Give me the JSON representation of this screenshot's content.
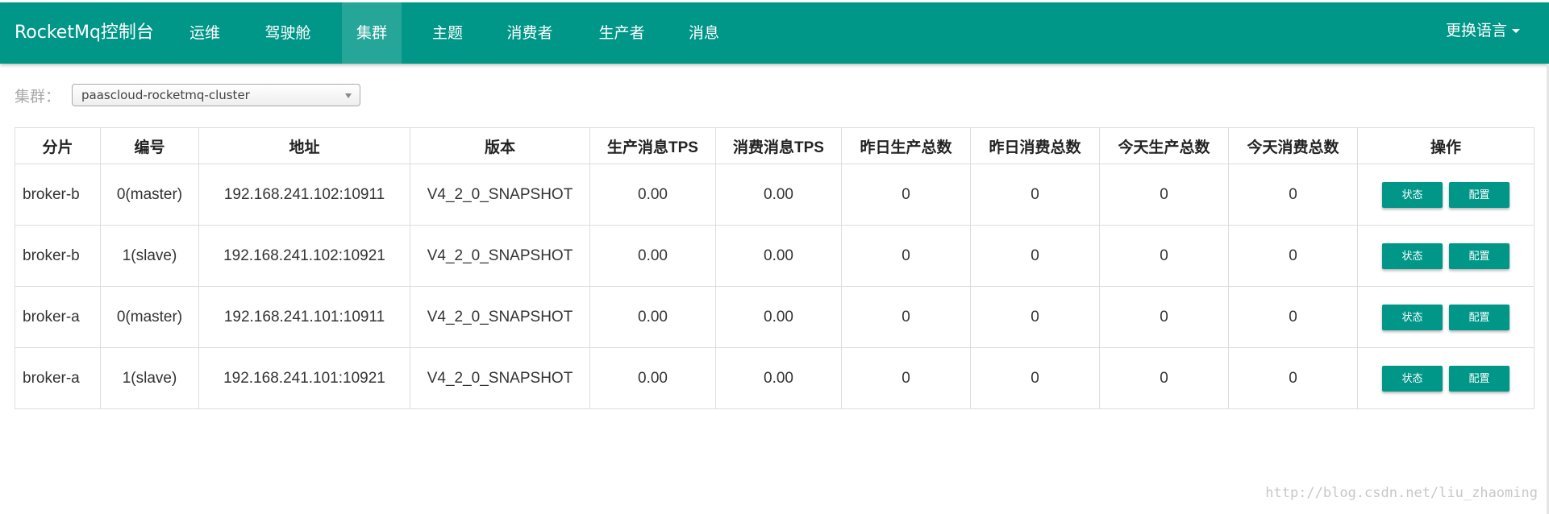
{
  "app": {
    "brand": "RocketMq控制台",
    "nav": [
      "运维",
      "驾驶舱",
      "集群",
      "主题",
      "消费者",
      "生产者",
      "消息"
    ],
    "active_nav": "集群",
    "language_label": "更换语言",
    "accent_color": "#009688"
  },
  "filter": {
    "cluster_label": "集群：",
    "cluster_value": "paascloud-rocketmq-cluster"
  },
  "table": {
    "columns": [
      "分片",
      "编号",
      "地址",
      "版本",
      "生产消息TPS",
      "消费消息TPS",
      "昨日生产总数",
      "昨日消费总数",
      "今天生产总数",
      "今天消费总数",
      "操作"
    ],
    "rows": [
      [
        "broker-b",
        "0(master)",
        "192.168.241.102:10911",
        "V4_2_0_SNAPSHOT",
        "0.00",
        "0.00",
        "0",
        "0",
        "0",
        "0"
      ],
      [
        "broker-b",
        "1(slave)",
        "192.168.241.102:10921",
        "V4_2_0_SNAPSHOT",
        "0.00",
        "0.00",
        "0",
        "0",
        "0",
        "0"
      ],
      [
        "broker-a",
        "0(master)",
        "192.168.241.101:10911",
        "V4_2_0_SNAPSHOT",
        "0.00",
        "0.00",
        "0",
        "0",
        "0",
        "0"
      ],
      [
        "broker-a",
        "1(slave)",
        "192.168.241.101:10921",
        "V4_2_0_SNAPSHOT",
        "0.00",
        "0.00",
        "0",
        "0",
        "0",
        "0"
      ]
    ],
    "status_button": "状态",
    "config_button": "配置"
  },
  "watermark": "http://blog.csdn.net/liu_zhaoming"
}
